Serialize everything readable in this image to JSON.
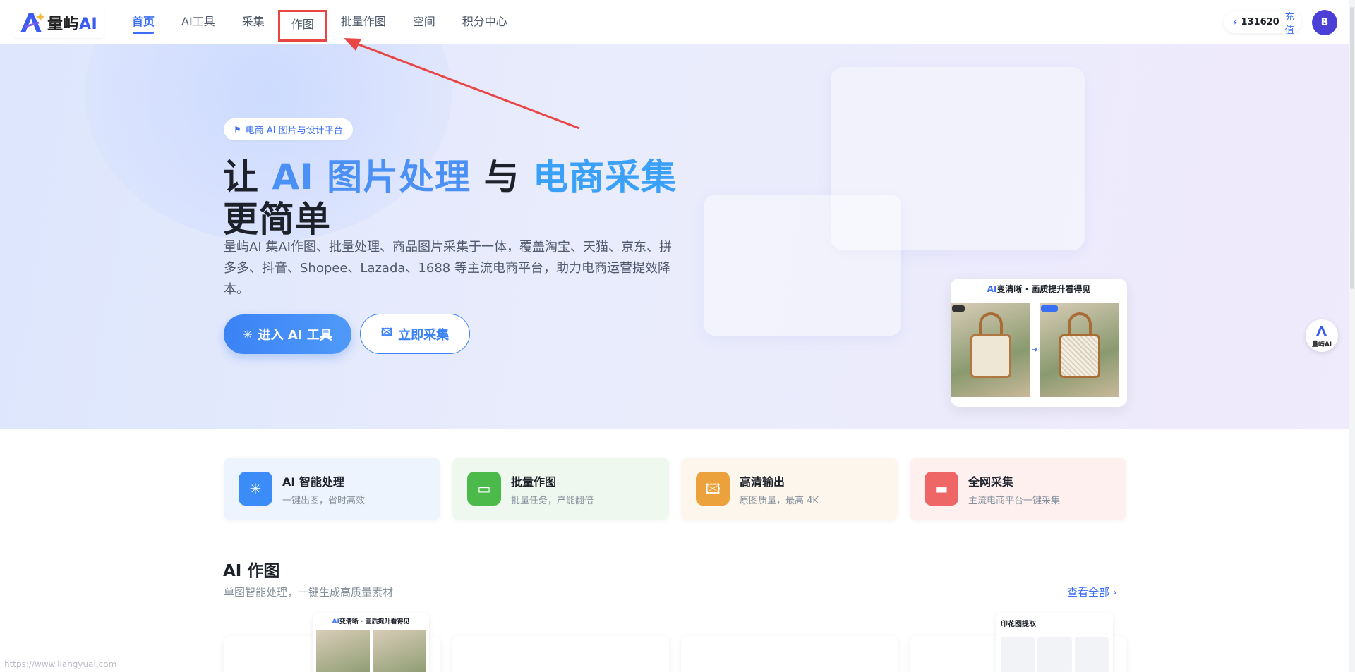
{
  "nav": {
    "logo_text": "量屿",
    "logo_ai": "AI",
    "items": [
      {
        "label": "首页",
        "active": true
      },
      {
        "label": "AI工具"
      },
      {
        "label": "采集"
      },
      {
        "label": "作图",
        "highlighted": true
      },
      {
        "label": "批量作图"
      },
      {
        "label": "空间"
      },
      {
        "label": "积分中心"
      }
    ],
    "credits": "131620",
    "recharge": "充值",
    "avatar": "B"
  },
  "hero": {
    "badge": "电商 AI 图片与设计平台",
    "headline_1": "让 ",
    "headline_ai": "AI 图片处理",
    "headline_2": " 与 ",
    "headline_collect": "电商采集",
    "headline_3": "更简单",
    "description": "量屿AI 集AI作图、批量处理、商品图片采集于一体，覆盖淘宝、天猫、京东、拼多多、抖音、Shopee、Lazada、1688 等主流电商平台，助力电商运营提效降本。",
    "btn_primary": "进入 AI 工具",
    "btn_secondary": "立即采集",
    "preview_title_ai": "AI",
    "preview_title": "变清晰 · 画质提升看得见",
    "side_float_label": "量屿AI"
  },
  "features": [
    {
      "title": "AI 智能处理",
      "subtitle": "一键出图，省时高效",
      "icon": "sparkle-icon",
      "color": "#3b8cf6",
      "bg": "#eef4fe"
    },
    {
      "title": "批量作图",
      "subtitle": "批量任务，产能翻倍",
      "icon": "layers-icon",
      "color": "#4cba4a",
      "bg": "#eff8ee"
    },
    {
      "title": "高清输出",
      "subtitle": "原图质量，最高 4K",
      "icon": "image-icon",
      "color": "#eba13c",
      "bg": "#fdf6ec"
    },
    {
      "title": "全网采集",
      "subtitle": "主流电商平台一键采集",
      "icon": "monitor-icon",
      "color": "#ef6666",
      "bg": "#fdf0ef"
    }
  ],
  "section": {
    "title": "AI 作图",
    "subtitle": "单图智能处理，一键生成高质量素材",
    "more": "查看全部 ›"
  },
  "thumbs": {
    "t1_ai": "AI",
    "t1_title": "变清晰 · 画质提升看得见",
    "t2_title": "印花图提取"
  },
  "watermark": "https://www.liangyuai.com"
}
